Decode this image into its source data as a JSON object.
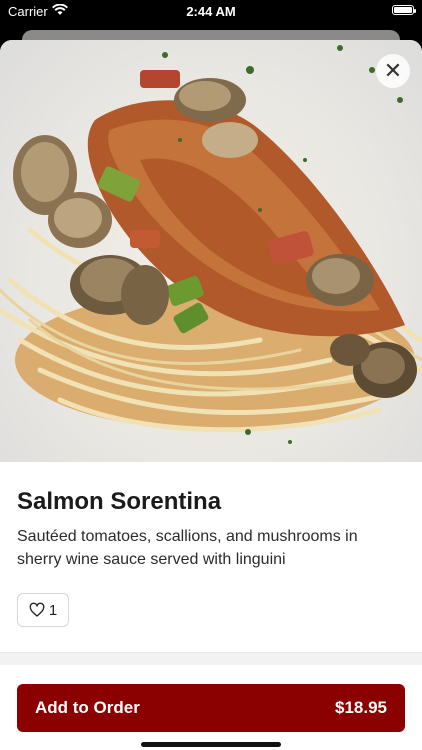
{
  "status_bar": {
    "carrier": "Carrier",
    "time": "2:44 AM",
    "icons": [
      "wifi-icon",
      "battery-icon"
    ]
  },
  "item": {
    "image_alt": "Salmon over linguini with mushrooms and tomatoes",
    "title": "Salmon Sorentina",
    "description": "Sautéed tomatoes, scallions, and mushrooms in sherry wine sauce served with linguini",
    "like_count": "1"
  },
  "actions": {
    "close_icon": "close-icon",
    "add_to_order_label": "Add to Order",
    "price": "$18.95"
  },
  "colors": {
    "accent": "#8b0000",
    "background": "#ffffff",
    "text": "#1b1b1b"
  }
}
